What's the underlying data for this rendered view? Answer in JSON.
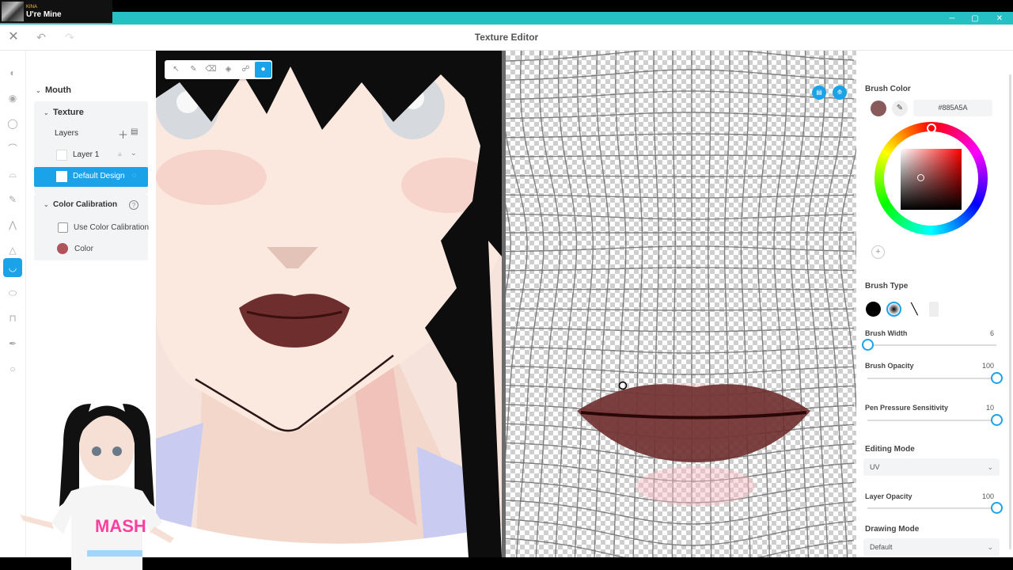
{
  "now_playing": {
    "artist": "KINA",
    "title": "U're Mine"
  },
  "window": {
    "title": "Texture Editor",
    "minimize": "─",
    "maximize": "▢",
    "close": "✕"
  },
  "header": {
    "close_icon": "✕",
    "undo_icon": "↶",
    "redo_icon": "↷"
  },
  "rail": {
    "icons": [
      "face-icon",
      "eye-icon",
      "eye-outline-icon",
      "eyebrow-icon",
      "ear-icon",
      "brush-icon",
      "eyelash-icon",
      "nose-icon",
      "mouth-icon",
      "lip-icon",
      "neck-icon",
      "pen-icon",
      "circle-icon"
    ],
    "active": "mouth-icon"
  },
  "layer_panel": {
    "root": "Mouth",
    "texture": "Texture",
    "layers_label": "Layers",
    "layer1": "Layer 1",
    "default_design": "Default Design",
    "color_calibration": "Color Calibration",
    "use_color_calibration": "Use Color Calibration",
    "use_color_calibration_checked": false,
    "color_label": "Color",
    "calibration_color": "#b0545c"
  },
  "viewport": {
    "tools": [
      "select-tool-icon",
      "pen-tool-icon",
      "eraser-tool-icon",
      "fill-tool-icon",
      "smudge-tool-icon",
      "dropper-tool-icon"
    ],
    "active_tool": "dropper-tool-icon"
  },
  "properties": {
    "brush_color_title": "Brush Color",
    "brush_color": "#885A5A",
    "hex_value": "#885A5A",
    "brush_type_title": "Brush Type",
    "brush_width_title": "Brush Width",
    "brush_width_value": "6",
    "brush_width_fraction": 0.0,
    "brush_opacity_title": "Brush Opacity",
    "brush_opacity_value": "100",
    "brush_opacity_fraction": 1.0,
    "pen_pressure_title": "Pen Pressure Sensitivity",
    "pen_pressure_value": "10",
    "pen_pressure_fraction": 1.0,
    "editing_mode_title": "Editing Mode",
    "editing_mode_value": "UV",
    "layer_opacity_title": "Layer Opacity",
    "layer_opacity_value": "100",
    "layer_opacity_fraction": 1.0,
    "drawing_mode_title": "Drawing Mode",
    "drawing_mode_value": "Default"
  },
  "colors": {
    "accent": "#1aa3e8",
    "title_bar": "#26c0c4"
  }
}
